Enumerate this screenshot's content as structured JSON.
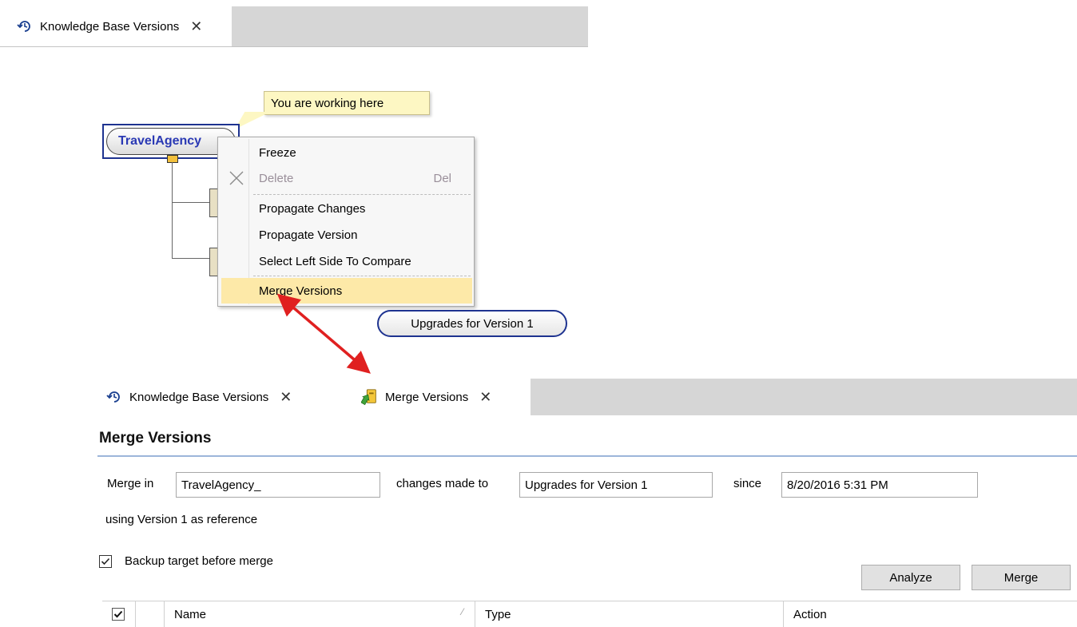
{
  "top_tabs": {
    "kb_versions_label": "Knowledge Base Versions",
    "close_glyph": "✕",
    "icon": "version-history-icon"
  },
  "tree": {
    "root_node": "TravelAgency_",
    "root_node_visible": "TravelAgency",
    "callout": "You are working here",
    "upgrades_node": "Upgrades for Version 1"
  },
  "context_menu": {
    "freeze": "Freeze",
    "delete": "Delete",
    "delete_shortcut": "Del",
    "propagate_changes": "Propagate Changes",
    "propagate_version": "Propagate Version",
    "select_left": "Select Left Side To Compare",
    "merge_versions": "Merge Versions",
    "highlight_color": "#fde9a8"
  },
  "bottom_tabs": {
    "kb_versions_label": "Knowledge Base Versions",
    "merge_versions_label": "Merge Versions",
    "close_glyph": "✕",
    "merge_icon": "merge-versions-icon"
  },
  "merge_panel": {
    "title": "Merge Versions",
    "merge_in_label": "Merge in",
    "merge_in_value": "TravelAgency_",
    "changes_made_to_label": "changes made to",
    "changes_made_to_value": "Upgrades for Version 1",
    "since_label": "since",
    "since_value": "8/20/2016 5:31 PM",
    "reference_text": "using Version 1 as reference",
    "backup_label": "Backup target before merge",
    "backup_checked": true,
    "analyze_button": "Analyze",
    "merge_button": "Merge"
  },
  "grid": {
    "columns": [
      "Name",
      "Type",
      "Action"
    ],
    "select_all_checked": true
  },
  "colors": {
    "node_border": "#1e3390",
    "node_text": "#2a39b4",
    "arrow": "#e02020",
    "title_rule": "#9db6da"
  }
}
